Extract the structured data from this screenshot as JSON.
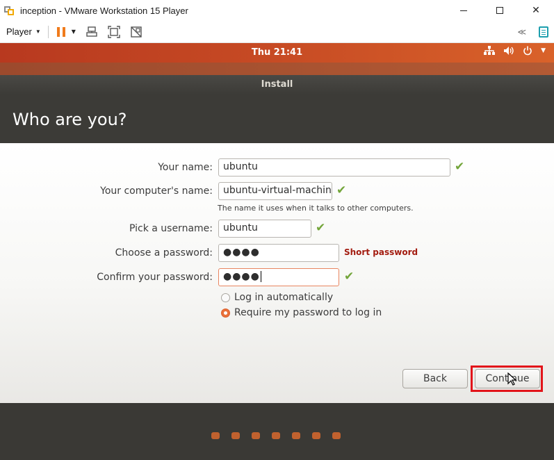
{
  "window": {
    "title": "inception - VMware Workstation 15 Player",
    "icon": "vmware-player-icon"
  },
  "toolbar": {
    "player_label": "Player",
    "icons": [
      "pause-icon",
      "send-ctrl-alt-del-icon",
      "fit-window-icon",
      "unity-icon",
      "collapse-toolbar-icon",
      "notes-icon"
    ]
  },
  "ubuntu_panel": {
    "clock": "Thu 21:41",
    "tray_icons": [
      "network-icon",
      "volume-icon",
      "power-icon",
      "menu-caret-icon"
    ]
  },
  "installer": {
    "window_title": "Install",
    "heading": "Who are you?",
    "fields": {
      "name": {
        "label": "Your name:",
        "value": "ubuntu",
        "valid": true
      },
      "computer": {
        "label": "Your computer's name:",
        "value": "ubuntu-virtual-machine",
        "hint": "The name it uses when it talks to other computers.",
        "valid": true
      },
      "username": {
        "label": "Pick a username:",
        "value": "ubuntu",
        "valid": true
      },
      "password": {
        "label": "Choose a password:",
        "value": "●●●●",
        "strength": "Short password"
      },
      "confirm": {
        "label": "Confirm your password:",
        "value": "●●●●",
        "valid": true
      }
    },
    "login_options": {
      "auto": {
        "label": "Log in automatically",
        "selected": false
      },
      "require": {
        "label": "Require my password to log in",
        "selected": true
      }
    },
    "buttons": {
      "back": "Back",
      "continue": "Continue"
    },
    "progress_steps": 7
  },
  "colors": {
    "ubuntu_orange": "#e9713a",
    "valid_check": "#73a53a",
    "error_text": "#a31c10",
    "highlight": "#e2141a"
  }
}
